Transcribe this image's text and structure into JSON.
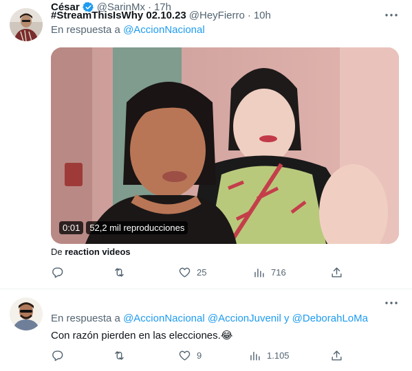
{
  "tweets": [
    {
      "author_name": "#StreamThisIsWhy 02.10.23",
      "handle": "@HeyFierro",
      "separator": "·",
      "time": "10h",
      "reply_prefix": "En respuesta a",
      "reply_mentions": [
        "@AccionNacional"
      ],
      "video": {
        "duration": "0:01",
        "views": "52,2 mil reproducciones"
      },
      "from_prefix": "De",
      "from_source": "reaction videos",
      "stats": {
        "replies": "",
        "retweets": "",
        "likes": "25",
        "views": "716"
      }
    },
    {
      "author_name": "César",
      "handle": "@SarinMx",
      "separator": "·",
      "time": "17h",
      "reply_prefix": "En respuesta a",
      "reply_mentions": [
        "@AccionNacional",
        "@AccionJuvenil"
      ],
      "reply_join": "y",
      "reply_mention_last": "@DeborahLoMa",
      "text": "Con razón pierden en las elecciones.😂",
      "stats": {
        "replies": "",
        "retweets": "",
        "likes": "9",
        "views": "1.105"
      }
    }
  ],
  "icons": {
    "reply": "reply-icon",
    "retweet": "retweet-icon",
    "like": "heart-icon",
    "views": "views-icon",
    "share": "share-icon",
    "more": "more-icon",
    "verified": "verified-badge-icon"
  },
  "colors": {
    "link": "#1d9bf0",
    "secondary": "#536471",
    "primary": "#0f1419",
    "verified": "#1d9bf0"
  }
}
